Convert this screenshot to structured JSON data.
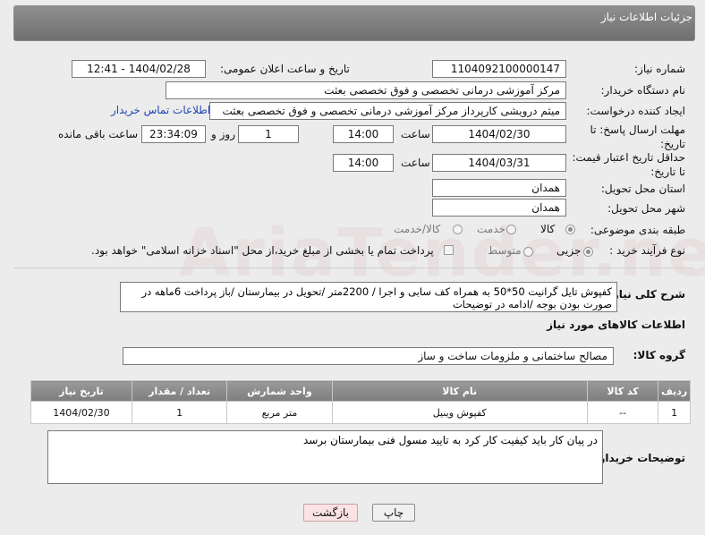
{
  "header": {
    "title": "جزئیات اطلاعات نیاز"
  },
  "watermark": "AriaTender.neT",
  "fields": {
    "need_number_label": "شماره نیاز:",
    "need_number": "1104092100000147",
    "announce_label": "تاریخ و ساعت اعلان عمومی:",
    "announce_value": "1404/02/28 - 12:41",
    "buyer_org_label": "نام دستگاه خریدار:",
    "buyer_org": "مرکز آموزشی درمانی تخصصی و فوق تخصصی بعثت",
    "creator_label": "ایجاد کننده درخواست:",
    "creator": "میثم درویشی کارپرداز مرکز آموزشی درمانی تخصصی و فوق تخصصی بعثت",
    "contact_link": "اطلاعات تماس خریدار",
    "deadline_label": "مهلت ارسال پاسخ: تا تاریخ:",
    "deadline_date": "1404/02/30",
    "time_label": "ساعت",
    "deadline_time": "14:00",
    "days_value": "1",
    "days_label": "روز و",
    "remaining_time": "23:34:09",
    "remaining_label": "ساعت باقی مانده",
    "price_validity_label": "حداقل تاریخ اعتبار قیمت: تا تاریخ:",
    "price_validity_date": "1404/03/31",
    "price_validity_time": "14:00",
    "province_label": "استان محل تحویل:",
    "province": "همدان",
    "city_label": "شهر محل تحویل:",
    "city": "همدان",
    "category_label": "طبقه بندی موضوعی:",
    "category_options": [
      "کالا",
      "خدمت",
      "کالا/خدمت"
    ],
    "process_label": "نوع فرآیند خرید :",
    "process_options": [
      "جزیی",
      "متوسط"
    ],
    "payment_note": "پرداخت تمام یا بخشی از مبلغ خرید،از محل \"اسناد خزانه اسلامی\" خواهد بود.",
    "description_label": "شرح کلی نیاز:",
    "description": "کفپوش تایل گرانیت 50*50 به همراه کف سابی و اجرا / 2200متر /تحویل در بیمارستان /باز پرداخت 6ماهه در صورت بودن بوجه /ادامه در توضیحات"
  },
  "goods_section": {
    "title": "اطلاعات کالاهای مورد نیاز",
    "group_label": "گروه کالا:",
    "group_value": "مصالح ساختمانی و ملزومات ساخت و ساز"
  },
  "table": {
    "headers": [
      "ردیف",
      "کد کالا",
      "نام کالا",
      "واحد شمارش",
      "تعداد / مقدار",
      "تاریخ نیاز"
    ],
    "rows": [
      [
        "1",
        "--",
        "کفپوش وینیل",
        "متر مربع",
        "1",
        "1404/02/30"
      ]
    ]
  },
  "buyer_notes": {
    "label": "توضیحات خریدار:",
    "value": "در پیان کار باید کیفیت کار کرد به تایید مسول فنی بیمارستان برسد"
  },
  "buttons": {
    "print": "چاپ",
    "back": "بازگشت"
  }
}
